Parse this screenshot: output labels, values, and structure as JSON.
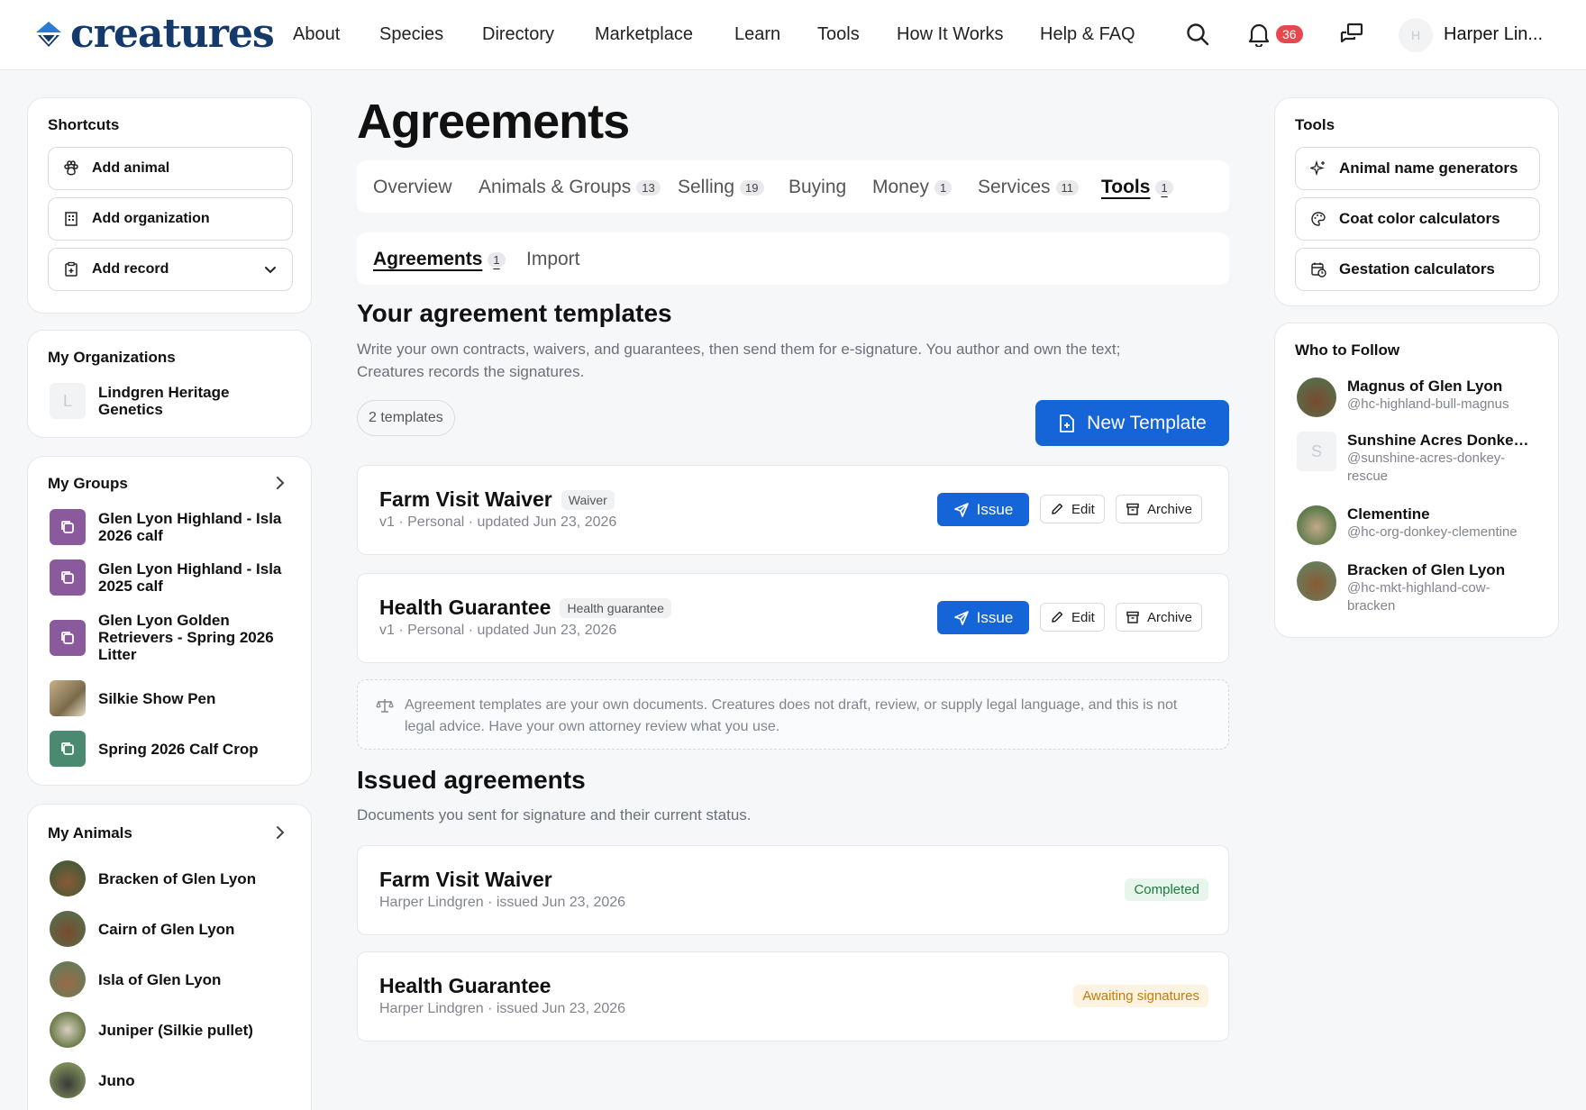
{
  "header": {
    "logo_text": "creatures",
    "nav": [
      "About",
      "Species",
      "Directory",
      "Marketplace",
      "Learn",
      "Tools",
      "How It Works",
      "Help & FAQ"
    ],
    "notification_count": "36",
    "avatar_initial": "H",
    "user_name": "Harper Lin..."
  },
  "left": {
    "shortcuts": {
      "title": "Shortcuts",
      "items": [
        {
          "label": "Add animal",
          "icon": "paw-icon"
        },
        {
          "label": "Add organization",
          "icon": "building-icon"
        },
        {
          "label": "Add record",
          "icon": "clipboard-icon"
        }
      ]
    },
    "orgs": {
      "title": "My Organizations",
      "items": [
        {
          "initial": "L",
          "label": "Lindgren Heritage Genetics"
        }
      ]
    },
    "groups": {
      "title": "My Groups",
      "items": [
        {
          "label": "Glen Lyon Highland - Isla 2026 calf",
          "color": "#8a5a9c"
        },
        {
          "label": "Glen Lyon Highland - Isla 2025 calf",
          "color": "#8a5a9c"
        },
        {
          "label": "Glen Lyon Golden Retrievers - Spring 2026 Litter",
          "color": "#8a5a9c"
        },
        {
          "label": "Silkie Show Pen",
          "color": "photo"
        },
        {
          "label": "Spring 2026 Calf Crop",
          "color": "#4a8a70"
        }
      ]
    },
    "animals": {
      "title": "My Animals",
      "items": [
        {
          "label": "Bracken of Glen Lyon"
        },
        {
          "label": "Cairn of Glen Lyon"
        },
        {
          "label": "Isla of Glen Lyon"
        },
        {
          "label": "Juniper (Silkie pullet)"
        },
        {
          "label": "Juno"
        }
      ]
    }
  },
  "main": {
    "title": "Agreements",
    "tabs": [
      {
        "label": "Overview",
        "count": ""
      },
      {
        "label": "Animals & Groups",
        "count": "13"
      },
      {
        "label": "Selling",
        "count": "19"
      },
      {
        "label": "Buying",
        "count": ""
      },
      {
        "label": "Money",
        "count": "1"
      },
      {
        "label": "Services",
        "count": "11"
      },
      {
        "label": "Tools",
        "count": "1"
      }
    ],
    "subtabs": [
      {
        "label": "Agreements",
        "count": "1"
      },
      {
        "label": "Import",
        "count": ""
      }
    ],
    "templates": {
      "title": "Your agreement templates",
      "description": "Write your own contracts, waivers, and guarantees, then send them for e-signature. You author and own the text; Creatures records the signatures.",
      "count_label": "2 templates",
      "new_button": "New Template",
      "items": [
        {
          "title": "Farm Visit Waiver",
          "tag": "Waiver",
          "meta": "v1 · Personal · updated Jun 23, 2026",
          "issue": "Issue",
          "edit": "Edit",
          "archive": "Archive"
        },
        {
          "title": "Health Guarantee",
          "tag": "Health guarantee",
          "meta": "v1 · Personal · updated Jun 23, 2026",
          "issue": "Issue",
          "edit": "Edit",
          "archive": "Archive"
        }
      ]
    },
    "notice": "Agreement templates are your own documents. Creatures does not draft, review, or supply legal language, and this is not legal advice. Have your own attorney review what you use.",
    "issued": {
      "title": "Issued agreements",
      "description": "Documents you sent for signature and their current status.",
      "items": [
        {
          "title": "Farm Visit Waiver",
          "meta": "Harper Lindgren · issued Jun 23, 2026",
          "status": "Completed",
          "status_color": "#1c7a3e"
        },
        {
          "title": "Health Guarantee",
          "meta": "Harper Lindgren · issued Jun 23, 2026",
          "status": "Awaiting signatures",
          "status_color": "#c87a0c"
        }
      ]
    }
  },
  "right": {
    "tools": {
      "title": "Tools",
      "items": [
        {
          "label": "Animal name generators",
          "icon": "sparkle-icon"
        },
        {
          "label": "Coat color calculators",
          "icon": "palette-icon"
        },
        {
          "label": "Gestation calculators",
          "icon": "calendar-clock-icon"
        }
      ]
    },
    "follow": {
      "title": "Who to Follow",
      "items": [
        {
          "name": "Magnus of Glen Lyon",
          "handle": "@hc-highland-bull-magnus"
        },
        {
          "name": "Sunshine Acres Donkey ...",
          "handle": "@sunshine-acres-donkey-rescue",
          "initial": "S"
        },
        {
          "name": "Clementine",
          "handle": "@hc-org-donkey-clementine"
        },
        {
          "name": "Bracken of Glen Lyon",
          "handle": "@hc-mkt-highland-cow-bracken"
        }
      ]
    }
  }
}
